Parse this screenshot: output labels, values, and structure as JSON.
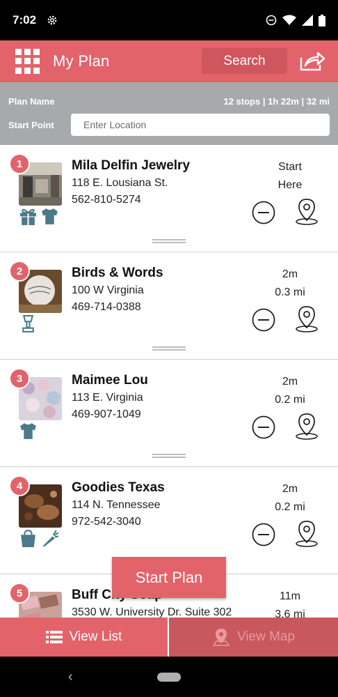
{
  "status": {
    "time": "7:02"
  },
  "app": {
    "title": "My Plan",
    "search_label": "Search"
  },
  "plan": {
    "name_label": "Plan Name",
    "stats": "12 stops | 1h 22m | 32 mi",
    "start_label": "Start Point",
    "location_placeholder": "Enter Location"
  },
  "stops": [
    {
      "number": "1",
      "name": "Mila Delfin Jewelry",
      "address": "118 E. Lousiana St.",
      "phone": "562-810-5274",
      "time": "Start",
      "distance": "Here",
      "categories": [
        "gift-icon",
        "tshirt-icon"
      ]
    },
    {
      "number": "2",
      "name": "Birds & Words",
      "address": "100 W Virginia",
      "phone": "469-714-0388",
      "time": "2m",
      "distance": "0.3 mi",
      "categories": [
        "lamp-icon"
      ]
    },
    {
      "number": "3",
      "name": "Maimee Lou",
      "address": "113 E. Virginia",
      "phone": "469-907-1049",
      "time": "2m",
      "distance": "0.2 mi",
      "categories": [
        "tshirt-icon"
      ]
    },
    {
      "number": "4",
      "name": "Goodies Texas",
      "address": "114 N. Tennessee",
      "phone": "972-542-3040",
      "time": "2m",
      "distance": "0.2 mi",
      "categories": [
        "shopping-bag-icon",
        "carrot-icon"
      ]
    },
    {
      "number": "5",
      "name": "Buff City Soap",
      "address": "3530 W. University Dr. Suite 302",
      "phone": "",
      "time": "11m",
      "distance": "3.6 mi",
      "categories": []
    }
  ],
  "actions": {
    "start_plan": "Start Plan"
  },
  "tabs": {
    "view_list": "View List",
    "view_map": "View Map"
  },
  "colors": {
    "primary": "#e2636a",
    "header_gray": "#a8a9ab",
    "icon_teal": "#4b7a88"
  }
}
